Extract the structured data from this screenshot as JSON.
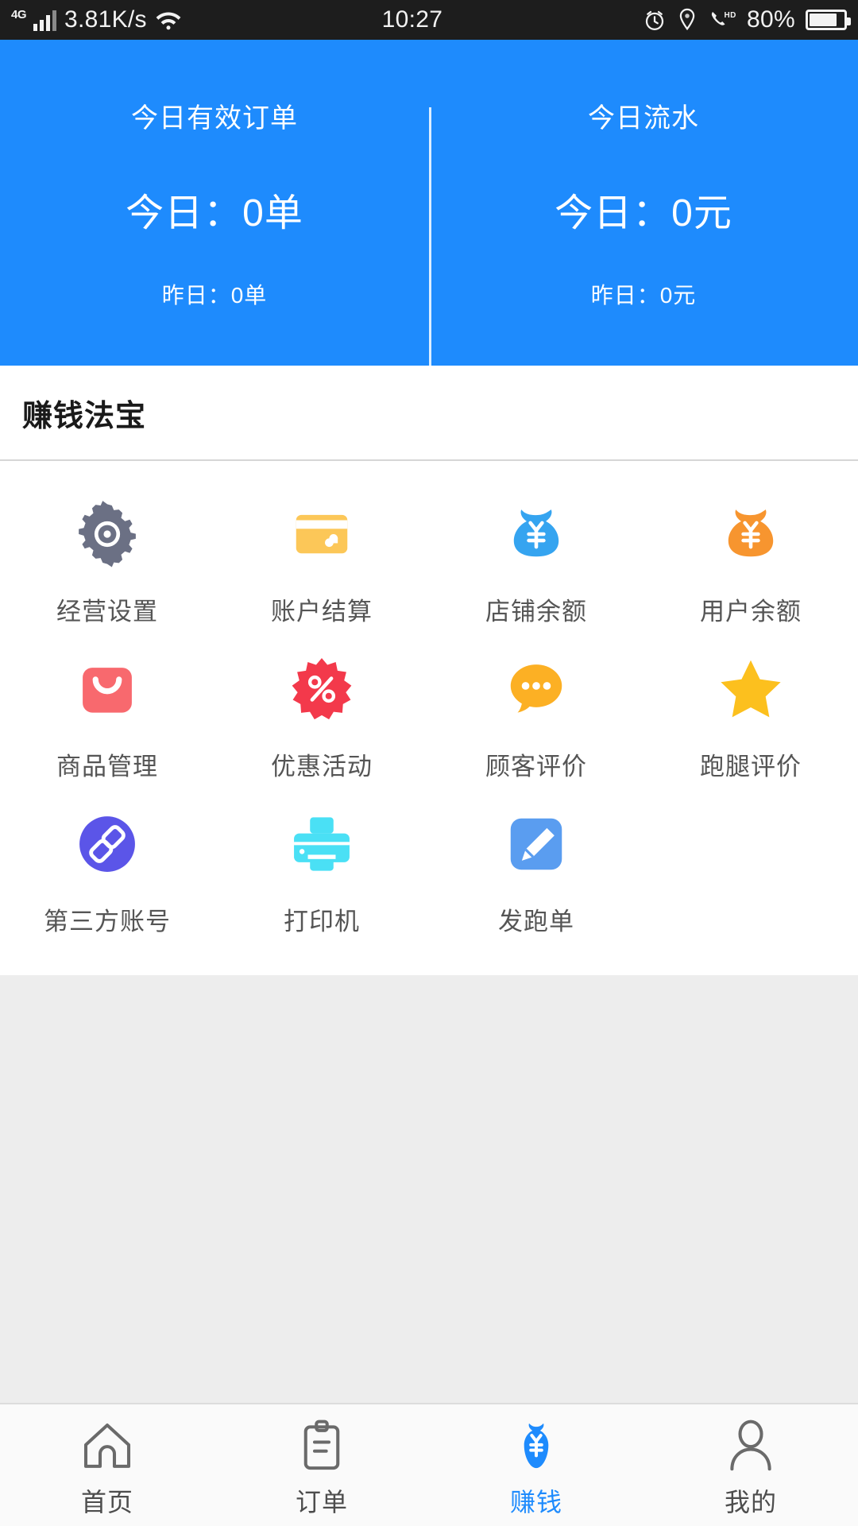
{
  "status_bar": {
    "network_type": "4G",
    "speed": "3.81K/s",
    "time": "10:27",
    "battery_text": "80%",
    "battery_level": 80,
    "icons": [
      "signal-icon",
      "wifi-icon",
      "alarm-icon",
      "location-icon",
      "hd-call-icon",
      "battery-icon"
    ]
  },
  "header": {
    "background_color": "#1e8bfd",
    "stats": [
      {
        "title": "今日有效订单",
        "today": "今日：0单",
        "yesterday": "昨日：0单"
      },
      {
        "title": "今日流水",
        "today": "今日：0元",
        "yesterday": "昨日：0元"
      }
    ]
  },
  "section": {
    "title": "赚钱法宝",
    "items": [
      {
        "label": "经营设置",
        "icon": "gear-icon",
        "color": "#6b7084"
      },
      {
        "label": "账户结算",
        "icon": "bank-card-icon",
        "color": "#fcc758"
      },
      {
        "label": "店铺余额",
        "icon": "money-bag-icon",
        "color": "#35a4f0"
      },
      {
        "label": "用户余额",
        "icon": "money-bag-icon",
        "color": "#f7952f"
      },
      {
        "label": "商品管理",
        "icon": "shopping-bag-icon",
        "color": "#f8696e"
      },
      {
        "label": "优惠活动",
        "icon": "discount-icon",
        "color": "#f3394b"
      },
      {
        "label": "顾客评价",
        "icon": "chat-bubble-icon",
        "color": "#fcb024"
      },
      {
        "label": "跑腿评价",
        "icon": "star-icon",
        "color": "#fcc01e"
      },
      {
        "label": "第三方账号",
        "icon": "link-icon",
        "color": "#5b55e8"
      },
      {
        "label": "打印机",
        "icon": "printer-icon",
        "color": "#4ae0f5"
      },
      {
        "label": "发跑单",
        "icon": "pencil-icon",
        "color": "#5a9df0"
      }
    ]
  },
  "tabbar": {
    "active_color": "#1e8bfd",
    "inactive_color": "#4d4d4d",
    "tabs": [
      {
        "label": "首页",
        "icon": "home-icon",
        "active": false
      },
      {
        "label": "订单",
        "icon": "clipboard-icon",
        "active": false
      },
      {
        "label": "赚钱",
        "icon": "money-bag-icon",
        "active": true
      },
      {
        "label": "我的",
        "icon": "person-icon",
        "active": false
      }
    ]
  }
}
